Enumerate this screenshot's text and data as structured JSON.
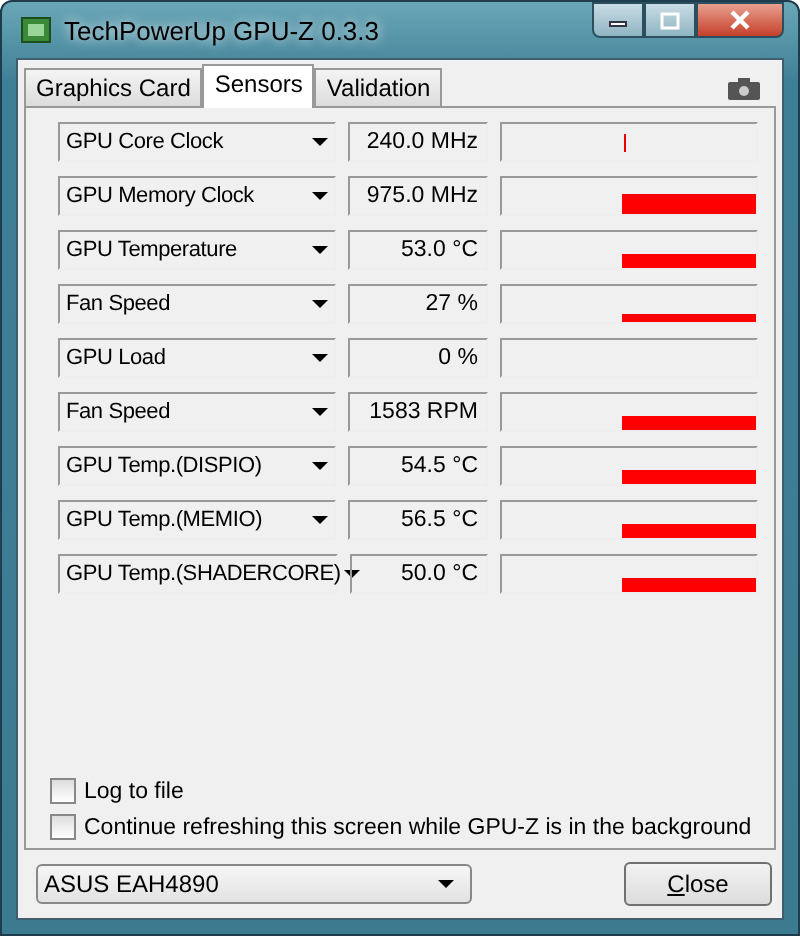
{
  "window": {
    "title": "TechPowerUp GPU-Z 0.3.3"
  },
  "tabs": [
    {
      "label": "Graphics Card",
      "selected": false
    },
    {
      "label": "Sensors",
      "selected": true
    },
    {
      "label": "Validation",
      "selected": false
    }
  ],
  "sensors": [
    {
      "name": "GPU Core Clock",
      "reading": "240.0 MHz",
      "kind": "spike"
    },
    {
      "name": "GPU Memory Clock",
      "reading": "975.0 MHz",
      "kind": "tall"
    },
    {
      "name": "GPU Temperature",
      "reading": "53.0 °C",
      "kind": "medium"
    },
    {
      "name": "Fan Speed",
      "reading": "27 %",
      "kind": "thin"
    },
    {
      "name": "GPU Load",
      "reading": "0 %",
      "kind": "empty"
    },
    {
      "name": "Fan Speed",
      "reading": "1583 RPM",
      "kind": "medium"
    },
    {
      "name": "GPU Temp.(DISPIO)",
      "reading": "54.5 °C",
      "kind": "medium"
    },
    {
      "name": "GPU Temp.(MEMIO)",
      "reading": "56.5 °C",
      "kind": "medium"
    },
    {
      "name": "GPU Temp.(SHADERCORE)",
      "reading": "50.0 °C",
      "kind": "medium"
    }
  ],
  "options": [
    {
      "label": "Log to file",
      "checked": false
    },
    {
      "label": "Continue refreshing this screen while GPU-Z is in the background",
      "checked": false
    }
  ],
  "card_select": {
    "value": "ASUS EAH4890"
  },
  "buttons": [
    {
      "label": "Close"
    }
  ]
}
